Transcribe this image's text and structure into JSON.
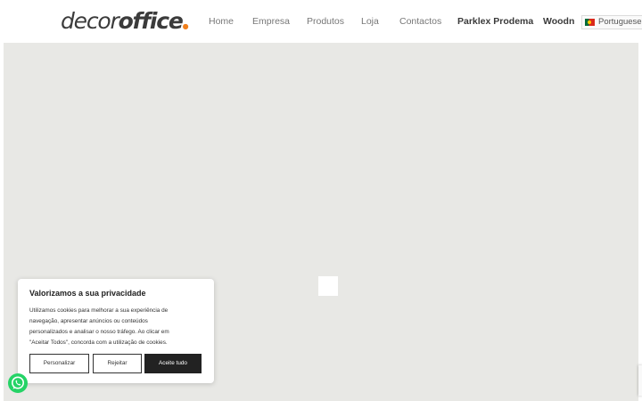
{
  "brand": {
    "logo_part1": "decor",
    "logo_part2": "office",
    "logo_dot": "●",
    "accent_color": "#f07f1b"
  },
  "nav": {
    "items": [
      {
        "label": "Home"
      },
      {
        "label": "Empresa"
      },
      {
        "label": "Produtos"
      },
      {
        "label": "Loja"
      },
      {
        "label": "Contactos"
      },
      {
        "label": "Parklex Prodema"
      },
      {
        "label": "Woodn"
      }
    ]
  },
  "language": {
    "selected": "Portuguese",
    "flag_icon": "portugal-flag-icon"
  },
  "map": {
    "background_color": "#e8e8e5"
  },
  "cookie_banner": {
    "title": "Valorizamos a sua privacidade",
    "text_lines": [
      "Utilizamos cookies para melhorar a sua experiência de",
      "navegação, apresentar anúncios ou conteúdos",
      "personalizados e analisar o nosso tráfego. Ao clicar em",
      "\"Aceitar Todos\", concorda com a utilização de cookies."
    ],
    "buttons": {
      "customize": "Personalizar",
      "reject": "Rejeitar",
      "accept": "Aceite tudo"
    }
  },
  "floating": {
    "whatsapp_icon": "whatsapp-icon",
    "whatsapp_color": "#25d366"
  }
}
